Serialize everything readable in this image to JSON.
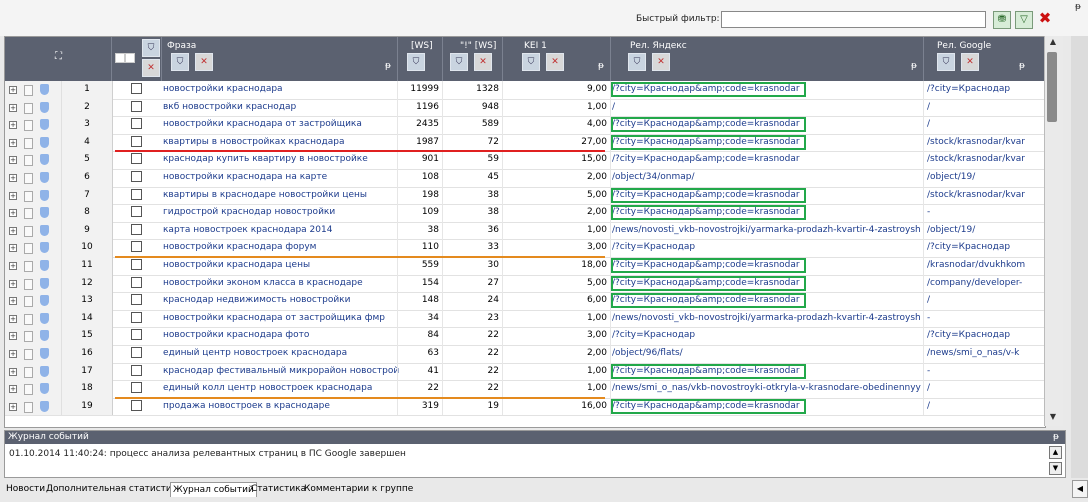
{
  "filter": {
    "label": "Быстрый фильтр:",
    "value": "",
    "close_glyph": "✖",
    "pin_glyph": "ᵽ"
  },
  "grid": {
    "headers": {
      "icons": "⛶",
      "phrase": "Фраза",
      "ws": "[WS]",
      "ws_exact": "\"!\" [WS]",
      "kei": "KEI 1",
      "yandex": "Рел. Яндекс",
      "google": "Рел. Google",
      "pin": "ᵽ"
    },
    "rows": [
      {
        "n": "1",
        "phrase": "новостройки краснодара",
        "ws": "11999",
        "ws1": "1328",
        "kei": "9,00",
        "ya": "/?city=Краснодар&amp;code=krasnodar",
        "go": "/?city=Краснодар",
        "box": true
      },
      {
        "n": "2",
        "phrase": "вкб новостройки краснодар",
        "ws": "1196",
        "ws1": "948",
        "kei": "1,00",
        "ya": "/",
        "go": "/",
        "box": false
      },
      {
        "n": "3",
        "phrase": "новостройки краснодара от застройщика",
        "ws": "2435",
        "ws1": "589",
        "kei": "4,00",
        "ya": "/?city=Краснодар&amp;code=krasnodar",
        "go": "/",
        "box": true
      },
      {
        "n": "4",
        "phrase": "квартиры в новостройках краснодара",
        "ws": "1987",
        "ws1": "72",
        "kei": "27,00",
        "ya": "/?city=Краснодар&amp;code=krasnodar",
        "go": "/stock/krasnodar/kvar",
        "box": true
      },
      {
        "n": "5",
        "phrase": "краснодар купить квартиру в новостройке",
        "ws": "901",
        "ws1": "59",
        "kei": "15,00",
        "ya": "/?city=Краснодар&amp;code=krasnodar",
        "go": "/stock/krasnodar/kvar",
        "box": false
      },
      {
        "n": "6",
        "phrase": "новостройки краснодара на карте",
        "ws": "108",
        "ws1": "45",
        "kei": "2,00",
        "ya": "/object/34/onmap/",
        "go": "/object/19/",
        "box": false
      },
      {
        "n": "7",
        "phrase": "квартиры в краснодаре новостройки цены",
        "ws": "198",
        "ws1": "38",
        "kei": "5,00",
        "ya": "/?city=Краснодар&amp;code=krasnodar",
        "go": "/stock/krasnodar/kvar",
        "box": true
      },
      {
        "n": "8",
        "phrase": "гидрострой краснодар новостройки",
        "ws": "109",
        "ws1": "38",
        "kei": "2,00",
        "ya": "/?city=Краснодар&amp;code=krasnodar",
        "go": "-",
        "box": true
      },
      {
        "n": "9",
        "phrase": "карта новостроек краснодара 2014",
        "ws": "38",
        "ws1": "36",
        "kei": "1,00",
        "ya": "/news/novosti_vkb-novostrojki/yarmarka-prodazh-kvartir-4-zastroysh",
        "go": "/object/19/",
        "box": false
      },
      {
        "n": "10",
        "phrase": "новостройки краснодара форум",
        "ws": "110",
        "ws1": "33",
        "kei": "3,00",
        "ya": "/?city=Краснодар",
        "go": "/?city=Краснодар",
        "box": false
      },
      {
        "n": "11",
        "phrase": "новостройки краснодара цены",
        "ws": "559",
        "ws1": "30",
        "kei": "18,00",
        "ya": "/?city=Краснодар&amp;code=krasnodar",
        "go": "/krasnodar/dvukhkom",
        "box": true
      },
      {
        "n": "12",
        "phrase": "новостройки эконом класса в краснодаре",
        "ws": "154",
        "ws1": "27",
        "kei": "5,00",
        "ya": "/?city=Краснодар&amp;code=krasnodar",
        "go": "/company/developer-",
        "box": true
      },
      {
        "n": "13",
        "phrase": "краснодар недвижимость новостройки",
        "ws": "148",
        "ws1": "24",
        "kei": "6,00",
        "ya": "/?city=Краснодар&amp;code=krasnodar",
        "go": "/",
        "box": true
      },
      {
        "n": "14",
        "phrase": "новостройки краснодара от застройщика фмр",
        "ws": "34",
        "ws1": "23",
        "kei": "1,00",
        "ya": "/news/novosti_vkb-novostrojki/yarmarka-prodazh-kvartir-4-zastroysh",
        "go": "-",
        "box": false
      },
      {
        "n": "15",
        "phrase": "новостройки краснодара фото",
        "ws": "84",
        "ws1": "22",
        "kei": "3,00",
        "ya": "/?city=Краснодар",
        "go": "/?city=Краснодар",
        "box": false
      },
      {
        "n": "16",
        "phrase": "единый центр новостроек краснодара",
        "ws": "63",
        "ws1": "22",
        "kei": "2,00",
        "ya": "/object/96/flats/",
        "go": "/news/smi_o_nas/v-k",
        "box": false
      },
      {
        "n": "17",
        "phrase": "краснодар фестивальный микрорайон новострой",
        "ws": "41",
        "ws1": "22",
        "kei": "1,00",
        "ya": "/?city=Краснодар&amp;code=krasnodar",
        "go": "-",
        "box": true
      },
      {
        "n": "18",
        "phrase": "единый колл центр новостроек краснодара",
        "ws": "22",
        "ws1": "22",
        "kei": "1,00",
        "ya": "/news/smi_o_nas/vkb-novostroyki-otkryla-v-krasnodare-obedinennyy",
        "go": "/",
        "box": false
      },
      {
        "n": "19",
        "phrase": "продажа новостроек в краснодаре",
        "ws": "319",
        "ws1": "19",
        "kei": "16,00",
        "ya": "/?city=Краснодар&amp;code=krasnodar",
        "go": "/",
        "box": true
      }
    ]
  },
  "log": {
    "title": "Журнал событий",
    "lines": [
      "01.10.2014 11:40:24: процесс анализа релевантных страниц в ПС Google завершен"
    ]
  },
  "tabs": [
    "Новости",
    "Дополнительная статистика",
    "Журнал событий",
    "Статистика",
    "Комментарии к группе"
  ],
  "active_tab": "Журнал событий",
  "colors": {
    "header_bg": "#5b6170",
    "link": "#1c3b8c",
    "box_green": "#22a84a",
    "line_red": "#e02020",
    "line_orange": "#e48a1e"
  }
}
